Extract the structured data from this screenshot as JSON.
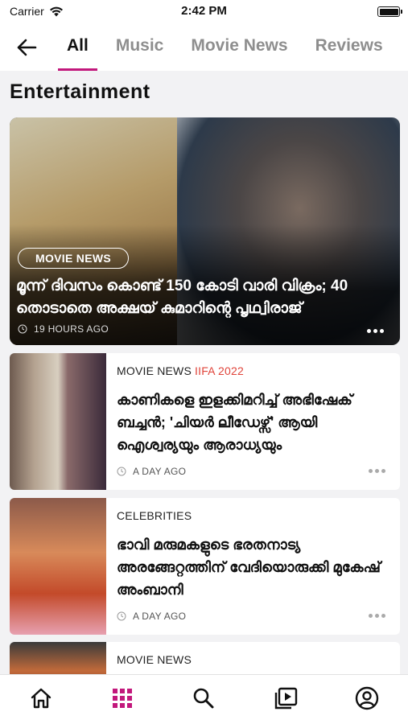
{
  "status_bar": {
    "carrier": "Carrier",
    "time": "2:42 PM"
  },
  "nav": {
    "tabs": [
      {
        "label": "All",
        "active": true
      },
      {
        "label": "Music",
        "active": false
      },
      {
        "label": "Movie News",
        "active": false
      },
      {
        "label": "Reviews",
        "active": false
      }
    ]
  },
  "section_title": "Entertainment",
  "hero": {
    "badge": "MOVIE NEWS",
    "title": "മൂന്ന് ദിവസം കൊണ്ട് 150 കോടി വാരി വിക്രം; 40 തൊടാതെ അക്ഷയ് കുമാറിന്റെ പൃഥ്വിരാജ്",
    "time": "19 HOURS AGO"
  },
  "articles": [
    {
      "category": "MOVIE NEWS",
      "tag": "IIFA 2022",
      "title": "കാണികളെ ഇളക്കിമറിച്ച് അഭിഷേക് ബച്ചൻ; 'ചിയർ ലീഡേഴ്സ്' ആയി ഐശ്വര്യയും ആരാധ്യയും",
      "time": "A DAY AGO"
    },
    {
      "category": "CELEBRITIES",
      "tag": "",
      "title": "ഭാവി മരുമകളുടെ ഭരതനാട്യ അരങ്ങേറ്റത്തിന് വേദിയൊരുക്കി മുകേഷ് അംബാനി",
      "time": "A DAY AGO"
    },
    {
      "category": "MOVIE NEWS",
      "tag": "",
      "title": "",
      "time": ""
    }
  ],
  "colors": {
    "accent": "#c2187c",
    "tag": "#e0443a"
  },
  "tabbar": {
    "items": [
      "home-icon",
      "grid-icon",
      "search-icon",
      "video-icon",
      "profile-icon"
    ],
    "active": "grid-icon"
  }
}
